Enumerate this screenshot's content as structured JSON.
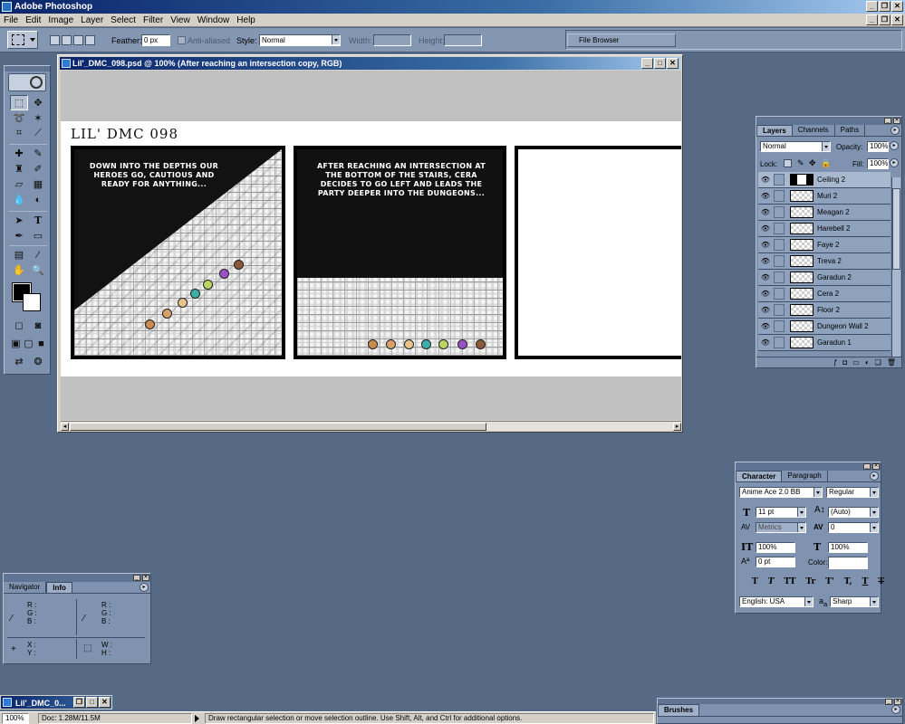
{
  "app": {
    "title": "Adobe Photoshop"
  },
  "menu": [
    "File",
    "Edit",
    "Image",
    "Layer",
    "Select",
    "Filter",
    "View",
    "Window",
    "Help"
  ],
  "options": {
    "feather_label": "Feather:",
    "feather_value": "0 px",
    "antialiased_label": "Anti-aliased",
    "style_label": "Style:",
    "style_value": "Normal",
    "width_label": "Width:",
    "height_label": "Height:",
    "file_browser": "File Browser"
  },
  "document": {
    "title": "Lil'_DMC_098.psd @ 100% (After reaching an intersection copy, RGB)",
    "comic_title": "LIL' DMC  098",
    "panel1_caption": "Down into the depths our heroes go, cautious and ready for anything...",
    "panel2_caption": "After reaching an intersection at the bottom of the stairs, Cera decides to go left and leads the party deeper into the dungeons..."
  },
  "layers_palette": {
    "tabs": [
      "Layers",
      "Channels",
      "Paths"
    ],
    "blend_mode": "Normal",
    "opacity_label": "Opacity:",
    "opacity": "100%",
    "lock_label": "Lock:",
    "fill_label": "Fill:",
    "fill": "100%",
    "layers": [
      "Ceiling 2",
      "Muri 2",
      "Meagan 2",
      "Harebell 2",
      "Faye 2",
      "Treva 2",
      "Garadun 2",
      "Cera 2",
      "Floor 2",
      "Dungeon Wall 2",
      "Garadun 1"
    ]
  },
  "character_palette": {
    "tabs": [
      "Character",
      "Paragraph"
    ],
    "font_family": "Anime Ace 2.0 BB",
    "font_style": "Regular",
    "font_size": "11 pt",
    "leading": "(Auto)",
    "kerning": "Metrics",
    "tracking": "0",
    "vertical_scale": "100%",
    "horizontal_scale": "100%",
    "baseline_shift": "0 pt",
    "color_label": "Color:",
    "type_buttons": [
      "T",
      "T",
      "TT",
      "Tr",
      "T'",
      "T,",
      "T",
      "T"
    ],
    "language": "English: USA",
    "aa_label": "a",
    "antialias": "Sharp"
  },
  "info_palette": {
    "tabs": [
      "Navigator",
      "Info"
    ],
    "rgb": [
      "R :",
      "G :",
      "B :"
    ],
    "rgb2": [
      "R :",
      "G :",
      "B :"
    ],
    "xy": [
      "X :",
      "Y :"
    ],
    "wh": [
      "W :",
      "H :"
    ]
  },
  "brushes": {
    "title": "Brushes"
  },
  "minimized_doc": {
    "title": "Lil'_DMC_0..."
  },
  "status": {
    "zoom": "100%",
    "doc": "Doc: 1.28M/11.5M",
    "hint": "Draw rectangular selection or move selection outline. Use Shift, Alt, and Ctrl for additional options."
  },
  "colors": {
    "desktop": "#566a85",
    "palette": "#7f93b0",
    "titlebar": "#0a246a"
  }
}
